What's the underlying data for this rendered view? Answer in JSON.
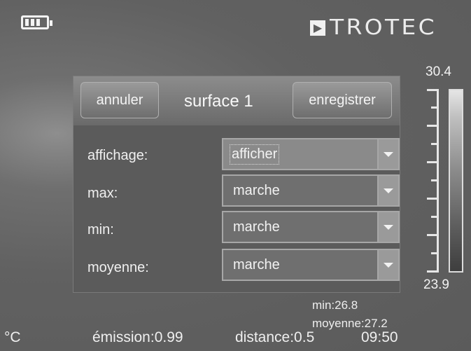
{
  "status": {
    "battery_icon": "battery-icon",
    "battery_bars": 3
  },
  "brand": {
    "mark": "▶",
    "name": "TROTEC"
  },
  "dialog": {
    "cancel_label": "annuler",
    "title": "surface 1",
    "save_label": "enregistrer",
    "rows": [
      {
        "label": "affichage:",
        "value": "afficher"
      },
      {
        "label": "max:",
        "value": "marche"
      },
      {
        "label": "min:",
        "value": "marche"
      },
      {
        "label": "moyenne:",
        "value": "marche"
      }
    ]
  },
  "scale": {
    "max": "30.4",
    "min": "23.9"
  },
  "stats": {
    "min": "min:26.8",
    "average": "moyenne:27.2"
  },
  "footer": {
    "unit": "°C",
    "emission": "émission:0.99",
    "distance": "distance:0.5",
    "time": "09:50"
  },
  "colors": {
    "background": "#5e5e5e",
    "text": "#f2f2f2"
  }
}
